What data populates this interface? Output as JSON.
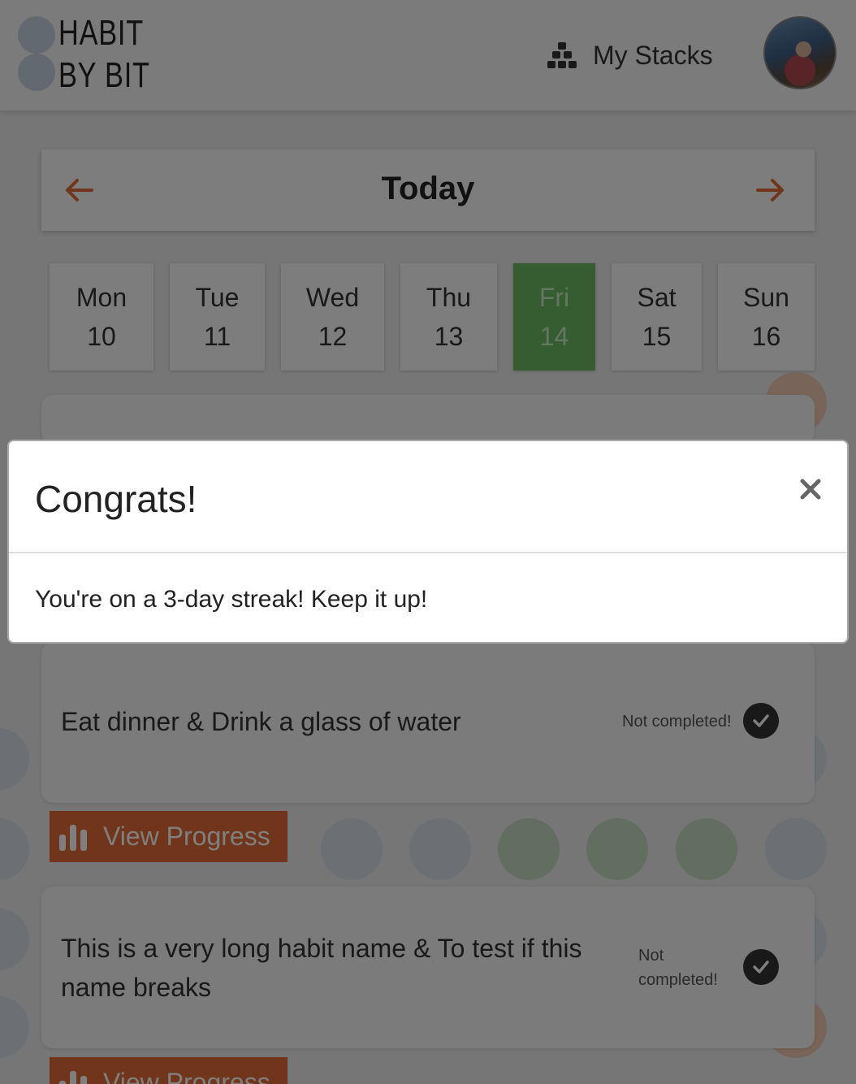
{
  "header": {
    "logo_line1": "HABIT",
    "logo_line2": "BY BIT",
    "stacks_label": "My Stacks",
    "stacks_icon": "stacks-icon",
    "avatar_icon": "user-avatar"
  },
  "date_nav": {
    "title": "Today",
    "prev_icon": "arrow-left-icon",
    "next_icon": "arrow-right-icon"
  },
  "week": {
    "days": [
      {
        "name": "Mon",
        "num": "10"
      },
      {
        "name": "Tue",
        "num": "11"
      },
      {
        "name": "Wed",
        "num": "12"
      },
      {
        "name": "Thu",
        "num": "13"
      },
      {
        "name": "Fri",
        "num": "14"
      },
      {
        "name": "Sat",
        "num": "15"
      },
      {
        "name": "Sun",
        "num": "16"
      }
    ],
    "selected_day": "Fri"
  },
  "habits": [
    {
      "name": "Eat dinner & Drink a glass of water",
      "status": "Not completed!",
      "action_label": "View Progress"
    },
    {
      "name": "This is a very long habit name & To test if this name breaks",
      "status": "Not completed!",
      "action_label": "View Progress"
    }
  ],
  "modal": {
    "title": "Congrats!",
    "message": "You're on a 3-day streak! Keep it up!",
    "close_icon": "close-icon"
  },
  "colors": {
    "accent": "#e06a35",
    "selected_day": "#6cb864",
    "check": "#333333"
  }
}
